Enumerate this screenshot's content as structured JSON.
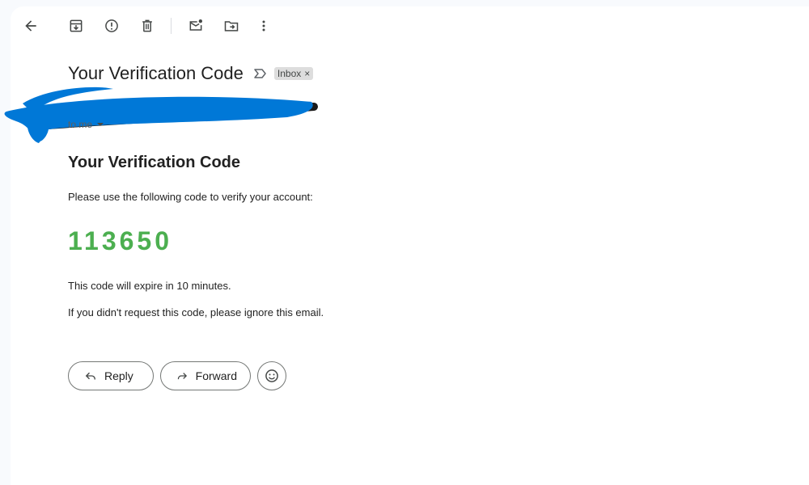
{
  "toolbar": {
    "icons": [
      "back-arrow-icon",
      "archive-icon",
      "report-spam-icon",
      "delete-icon",
      "mark-unread-icon",
      "move-to-icon",
      "more-options-icon"
    ]
  },
  "email": {
    "subject": "Your Verification Code",
    "label": "Inbox",
    "label_remove": "×",
    "recipient": "to me",
    "heading": "Your Verification Code",
    "intro": "Please use the following code to verify your account:",
    "code": "113650",
    "expiry": "This code will expire in 10 minutes.",
    "ignore": "If you didn't request this code, please ignore this email."
  },
  "actions": {
    "reply": "Reply",
    "forward": "Forward"
  },
  "colors": {
    "code": "#4caf50",
    "redaction": "#0078d7"
  }
}
